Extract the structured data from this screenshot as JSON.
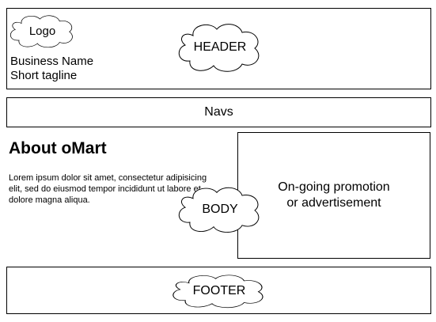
{
  "header": {
    "logo_label": "Logo",
    "cloud_label": "HEADER",
    "business_name": "Business Name",
    "tagline": "Short tagline"
  },
  "navs": {
    "label": "Navs"
  },
  "body": {
    "title": "About oMart",
    "text": "Lorem ipsum dolor sit amet, consectetur adipisicing\nelit, sed do eiusmod tempor incididunt ut labore et\ndolore magna aliqua.",
    "cloud_label": "BODY",
    "promo_label": "On-going promotion\nor advertisement"
  },
  "footer": {
    "cloud_label": "FOOTER"
  }
}
